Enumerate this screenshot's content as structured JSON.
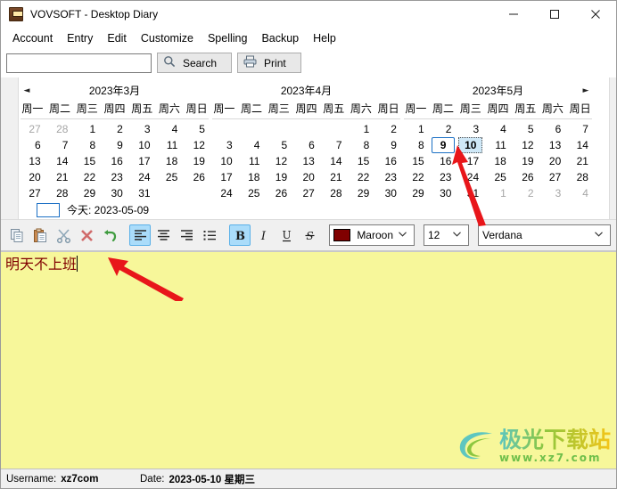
{
  "window": {
    "title": "VOVSOFT - Desktop Diary",
    "icon": "diary-book-icon",
    "controls": {
      "minimize": "—",
      "maximize": "□",
      "close": "✕"
    }
  },
  "menubar": {
    "items": [
      {
        "label": "Account",
        "name": "account"
      },
      {
        "label": "Entry",
        "name": "entry"
      },
      {
        "label": "Edit",
        "name": "edit"
      },
      {
        "label": "Customize",
        "name": "customize"
      },
      {
        "label": "Spelling",
        "name": "spelling"
      },
      {
        "label": "Backup",
        "name": "backup"
      },
      {
        "label": "Help",
        "name": "help"
      }
    ]
  },
  "searchbar": {
    "input_value": "",
    "input_placeholder": "",
    "search_label": "Search",
    "print_label": "Print"
  },
  "calendars": {
    "prev_arrow": "◄",
    "next_arrow": "►",
    "weekdays": [
      "周一",
      "周二",
      "周三",
      "周四",
      "周五",
      "周六",
      "周日"
    ],
    "months": [
      {
        "title": "2023年3月",
        "weeks": [
          [
            {
              "d": "27",
              "t": "other"
            },
            {
              "d": "28",
              "t": "other"
            },
            {
              "d": "1",
              "t": "day"
            },
            {
              "d": "2",
              "t": "day"
            },
            {
              "d": "3",
              "t": "day"
            },
            {
              "d": "4",
              "t": "day"
            },
            {
              "d": "5",
              "t": "day"
            }
          ],
          [
            {
              "d": "6",
              "t": "day"
            },
            {
              "d": "7",
              "t": "day"
            },
            {
              "d": "8",
              "t": "day"
            },
            {
              "d": "9",
              "t": "day"
            },
            {
              "d": "10",
              "t": "day"
            },
            {
              "d": "11",
              "t": "day"
            },
            {
              "d": "12",
              "t": "day"
            }
          ],
          [
            {
              "d": "13",
              "t": "day"
            },
            {
              "d": "14",
              "t": "day"
            },
            {
              "d": "15",
              "t": "day"
            },
            {
              "d": "16",
              "t": "day"
            },
            {
              "d": "17",
              "t": "day"
            },
            {
              "d": "18",
              "t": "day"
            },
            {
              "d": "19",
              "t": "day"
            }
          ],
          [
            {
              "d": "20",
              "t": "day"
            },
            {
              "d": "21",
              "t": "day"
            },
            {
              "d": "22",
              "t": "day"
            },
            {
              "d": "23",
              "t": "day"
            },
            {
              "d": "24",
              "t": "day"
            },
            {
              "d": "25",
              "t": "day"
            },
            {
              "d": "26",
              "t": "day"
            }
          ],
          [
            {
              "d": "27",
              "t": "day"
            },
            {
              "d": "28",
              "t": "day"
            },
            {
              "d": "29",
              "t": "day"
            },
            {
              "d": "30",
              "t": "day"
            },
            {
              "d": "31",
              "t": "day"
            },
            {
              "d": "",
              "t": "empty"
            },
            {
              "d": "",
              "t": "empty"
            }
          ]
        ]
      },
      {
        "title": "2023年4月",
        "weeks": [
          [
            {
              "d": "",
              "t": "empty"
            },
            {
              "d": "",
              "t": "empty"
            },
            {
              "d": "",
              "t": "empty"
            },
            {
              "d": "",
              "t": "empty"
            },
            {
              "d": "",
              "t": "empty"
            },
            {
              "d": "1",
              "t": "day"
            },
            {
              "d": "2",
              "t": "day"
            }
          ],
          [
            {
              "d": "3",
              "t": "day"
            },
            {
              "d": "4",
              "t": "day"
            },
            {
              "d": "5",
              "t": "day"
            },
            {
              "d": "6",
              "t": "day"
            },
            {
              "d": "7",
              "t": "day"
            },
            {
              "d": "8",
              "t": "day"
            },
            {
              "d": "9",
              "t": "day"
            }
          ],
          [
            {
              "d": "10",
              "t": "day"
            },
            {
              "d": "11",
              "t": "day"
            },
            {
              "d": "12",
              "t": "day"
            },
            {
              "d": "13",
              "t": "day"
            },
            {
              "d": "14",
              "t": "day"
            },
            {
              "d": "15",
              "t": "day"
            },
            {
              "d": "16",
              "t": "day"
            }
          ],
          [
            {
              "d": "17",
              "t": "day"
            },
            {
              "d": "18",
              "t": "day"
            },
            {
              "d": "19",
              "t": "day"
            },
            {
              "d": "20",
              "t": "day"
            },
            {
              "d": "21",
              "t": "day"
            },
            {
              "d": "22",
              "t": "day"
            },
            {
              "d": "23",
              "t": "day"
            }
          ],
          [
            {
              "d": "24",
              "t": "day"
            },
            {
              "d": "25",
              "t": "day"
            },
            {
              "d": "26",
              "t": "day"
            },
            {
              "d": "27",
              "t": "day"
            },
            {
              "d": "28",
              "t": "day"
            },
            {
              "d": "29",
              "t": "day"
            },
            {
              "d": "30",
              "t": "day"
            }
          ]
        ]
      },
      {
        "title": "2023年5月",
        "weeks": [
          [
            {
              "d": "1",
              "t": "day"
            },
            {
              "d": "2",
              "t": "day"
            },
            {
              "d": "3",
              "t": "day"
            },
            {
              "d": "4",
              "t": "day"
            },
            {
              "d": "5",
              "t": "day"
            },
            {
              "d": "6",
              "t": "day"
            },
            {
              "d": "7",
              "t": "day"
            }
          ],
          [
            {
              "d": "8",
              "t": "day"
            },
            {
              "d": "9",
              "t": "today"
            },
            {
              "d": "10",
              "t": "selected"
            },
            {
              "d": "11",
              "t": "day"
            },
            {
              "d": "12",
              "t": "day"
            },
            {
              "d": "13",
              "t": "day"
            },
            {
              "d": "14",
              "t": "day"
            }
          ],
          [
            {
              "d": "15",
              "t": "day"
            },
            {
              "d": "16",
              "t": "day"
            },
            {
              "d": "17",
              "t": "day"
            },
            {
              "d": "18",
              "t": "day"
            },
            {
              "d": "19",
              "t": "day"
            },
            {
              "d": "20",
              "t": "day"
            },
            {
              "d": "21",
              "t": "day"
            }
          ],
          [
            {
              "d": "22",
              "t": "day"
            },
            {
              "d": "23",
              "t": "day"
            },
            {
              "d": "24",
              "t": "day"
            },
            {
              "d": "25",
              "t": "day"
            },
            {
              "d": "26",
              "t": "day"
            },
            {
              "d": "27",
              "t": "day"
            },
            {
              "d": "28",
              "t": "day"
            }
          ],
          [
            {
              "d": "29",
              "t": "day"
            },
            {
              "d": "30",
              "t": "day"
            },
            {
              "d": "31",
              "t": "day"
            },
            {
              "d": "1",
              "t": "other"
            },
            {
              "d": "2",
              "t": "other"
            },
            {
              "d": "3",
              "t": "other"
            },
            {
              "d": "4",
              "t": "other"
            }
          ]
        ]
      }
    ],
    "today_label": "今天: 2023-05-09"
  },
  "formatbar": {
    "buttons": [
      {
        "name": "copy-icon",
        "label": "Copy",
        "active": false
      },
      {
        "name": "paste-icon",
        "label": "Paste",
        "active": false
      },
      {
        "name": "cut-icon",
        "label": "Cut",
        "active": false
      },
      {
        "name": "delete-icon",
        "label": "Delete",
        "active": false
      },
      {
        "name": "undo-icon",
        "label": "Undo",
        "active": false
      },
      {
        "name": "align-left-icon",
        "label": "Align Left",
        "active": true
      },
      {
        "name": "align-center-icon",
        "label": "Align Center",
        "active": false
      },
      {
        "name": "align-right-icon",
        "label": "Align Right",
        "active": false
      },
      {
        "name": "bullet-list-icon",
        "label": "Bullet List",
        "active": false
      },
      {
        "name": "bold-icon",
        "label": "Bold",
        "active": true
      },
      {
        "name": "italic-icon",
        "label": "Italic",
        "active": false
      },
      {
        "name": "underline-icon",
        "label": "Underline",
        "active": false
      },
      {
        "name": "strikethrough-icon",
        "label": "Strikethrough",
        "active": false
      }
    ],
    "color_select": {
      "value": "Maroon",
      "swatch": "#800000"
    },
    "size_select": {
      "value": "12"
    },
    "font_select": {
      "value": "Verdana"
    },
    "chevron": "ˇ"
  },
  "editor": {
    "text": "明天不上班",
    "text_color": "#800000",
    "background": "#f7f79a"
  },
  "watermark": {
    "title": "极光下载站",
    "url": "www.xz7.com"
  },
  "statusbar": {
    "username_label": "Username:",
    "username_value": "xz7com",
    "date_label": "Date:",
    "date_value": "2023-05-10 星期三"
  },
  "colors": {
    "accent": "#0078d7",
    "editor_bg": "#f7f79a",
    "maroon": "#800000",
    "selection": "#cfe8f7",
    "annotation_arrow": "#e8161a"
  }
}
